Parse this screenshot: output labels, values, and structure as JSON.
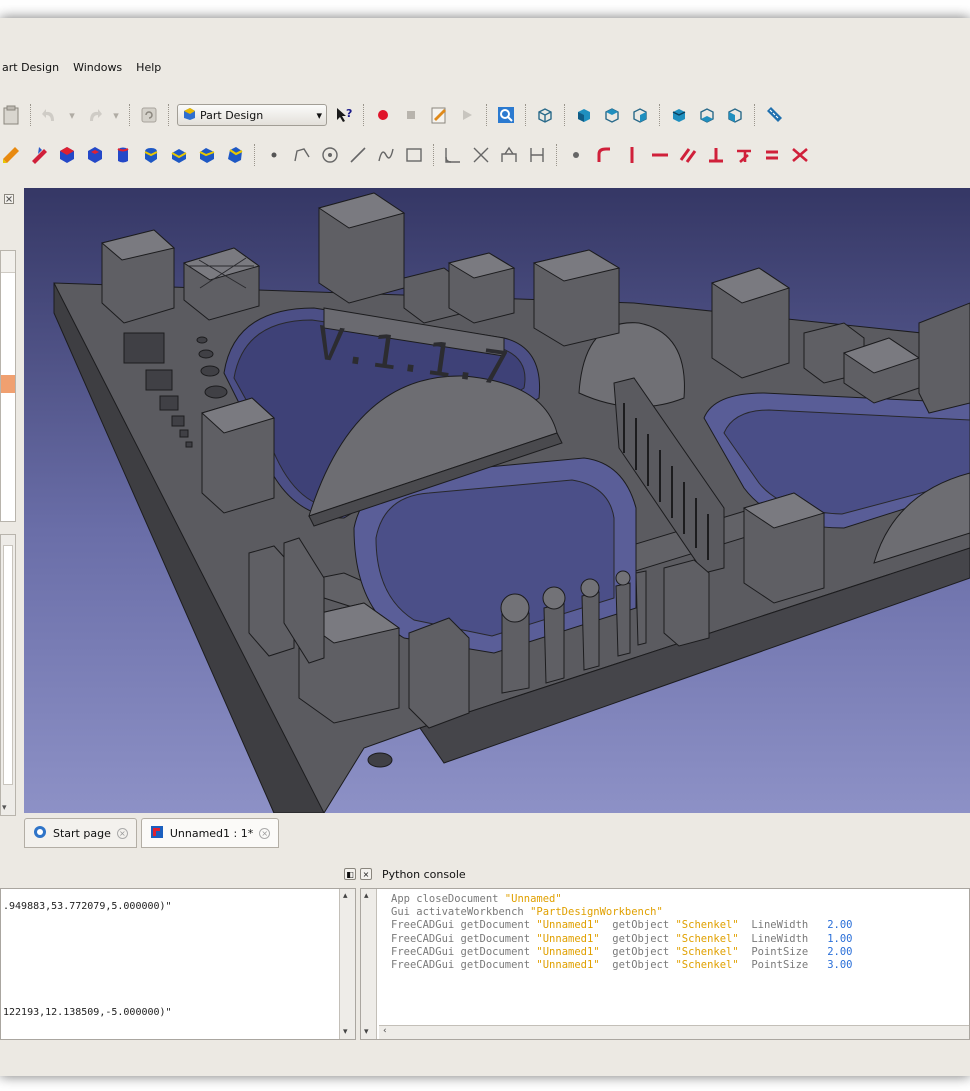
{
  "menu": {
    "items": [
      "art Design",
      "Windows",
      "Help"
    ]
  },
  "toolbar": {
    "workbench_value": "Part Design",
    "workbench_arrow": "▾"
  },
  "tabs": [
    {
      "label": "Start page"
    },
    {
      "label": "Unnamed1 : 1*"
    }
  ],
  "report": {
    "line1": ".949883,53.772079,5.000000)\"",
    "line2": "122193,12.138509,-5.000000)\""
  },
  "python_console": {
    "title": "Python console",
    "lines": [
      [
        [
          "k",
          "App closeDocument "
        ],
        [
          "s",
          "\"Unnamed\""
        ]
      ],
      [
        [
          "k",
          "Gui activateWorkbench "
        ],
        [
          "s",
          "\"PartDesignWorkbench\""
        ]
      ],
      [
        [
          "k",
          "FreeCADGui getDocument "
        ],
        [
          "s",
          "\"Unnamed1\""
        ],
        [
          "k",
          "  getObject "
        ],
        [
          "s",
          "\"Schenkel\""
        ],
        [
          "k",
          "  LineWidth   "
        ],
        [
          "n",
          "2.00"
        ]
      ],
      [
        [
          "k",
          "FreeCADGui getDocument "
        ],
        [
          "s",
          "\"Unnamed1\""
        ],
        [
          "k",
          "  getObject "
        ],
        [
          "s",
          "\"Schenkel\""
        ],
        [
          "k",
          "  LineWidth   "
        ],
        [
          "n",
          "1.00"
        ]
      ],
      [
        [
          "k",
          "FreeCADGui getDocument "
        ],
        [
          "s",
          "\"Unnamed1\""
        ],
        [
          "k",
          "  getObject "
        ],
        [
          "s",
          "\"Schenkel\""
        ],
        [
          "k",
          "  PointSize   "
        ],
        [
          "n",
          "2.00"
        ]
      ],
      [
        [
          "k",
          "FreeCADGui getDocument "
        ],
        [
          "s",
          "\"Unnamed1\""
        ],
        [
          "k",
          "  getObject "
        ],
        [
          "s",
          "\"Schenkel\""
        ],
        [
          "k",
          "  PointSize   "
        ],
        [
          "n",
          "3.00"
        ]
      ]
    ]
  },
  "colors": {
    "viewport_top": "#353765",
    "viewport_bottom": "#8d91c6",
    "model_gray": "#5a5a5e",
    "string_color": "#e0a000",
    "number_color": "#2a6fd8"
  }
}
